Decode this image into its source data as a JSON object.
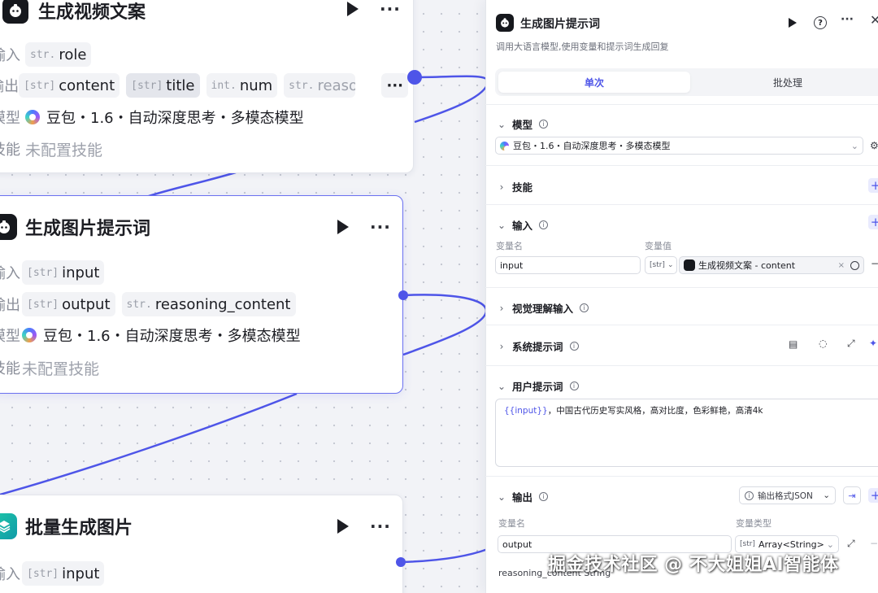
{
  "nodes": {
    "video_copy": {
      "title": "生成视频文案",
      "input_label": "输入",
      "input_tags": [
        {
          "type": "str.",
          "name": "role"
        }
      ],
      "output_label": "输出",
      "output_tags": [
        {
          "type": "[str]",
          "name": "content"
        },
        {
          "type": "[str]",
          "name": "title"
        },
        {
          "type": "int.",
          "name": "num"
        },
        {
          "type": "str.",
          "name": "reasonin"
        }
      ],
      "model_label": "模型",
      "model_value": "豆包・1.6・自动深度思考・多模态模型",
      "skill_label": "技能",
      "skill_value": "未配置技能"
    },
    "image_prompt": {
      "title": "生成图片提示词",
      "input_label": "输入",
      "input_tags": [
        {
          "type": "[str]",
          "name": "input"
        }
      ],
      "output_label": "输出",
      "output_tags": [
        {
          "type": "[str]",
          "name": "output"
        },
        {
          "type": "str.",
          "name": "reasoning_content"
        }
      ],
      "model_label": "模型",
      "model_value": "豆包・1.6・自动深度思考・多模态模型",
      "skill_label": "技能",
      "skill_value": "未配置技能"
    },
    "batch_images": {
      "title": "批量生成图片",
      "input_label": "输入",
      "input_tags": [
        {
          "type": "[str]",
          "name": "input"
        }
      ]
    }
  },
  "panel": {
    "title": "生成图片提示词",
    "description": "调用大语言模型,使用变量和提示词生成回复",
    "tabs": [
      "单次",
      "批处理"
    ],
    "active_tab": 0,
    "model_section": "模型",
    "model_value": "豆包・1.6・自动深度思考・多模态模型",
    "skills_section": "技能",
    "input_section": "输入",
    "var_name_label": "变量名",
    "var_value_label": "变量值",
    "input_name": "input",
    "input_type": "[str]",
    "input_ref": "生成视频文案 - content",
    "visual_section": "视觉理解输入",
    "system_prompt_section": "系统提示词",
    "user_prompt_section": "用户提示词",
    "user_prompt_var": "{{input}}",
    "user_prompt_text": "，中国古代历史写实风格，高对比度，色彩鲜艳，高清4k",
    "output_section": "输出",
    "output_format": "输出格式JSON",
    "out_name_label": "变量名",
    "out_type_label": "变量类型",
    "output_name": "output",
    "output_type": "Array<String>",
    "output_type_icon": "[str]",
    "reasoning_row": "reasoning_content  String"
  },
  "watermark": "掘金技术社区 @ 不大姐姐AI智能体",
  "colors": {
    "accent": "#4e55e8",
    "edge": "#4e55e8"
  }
}
